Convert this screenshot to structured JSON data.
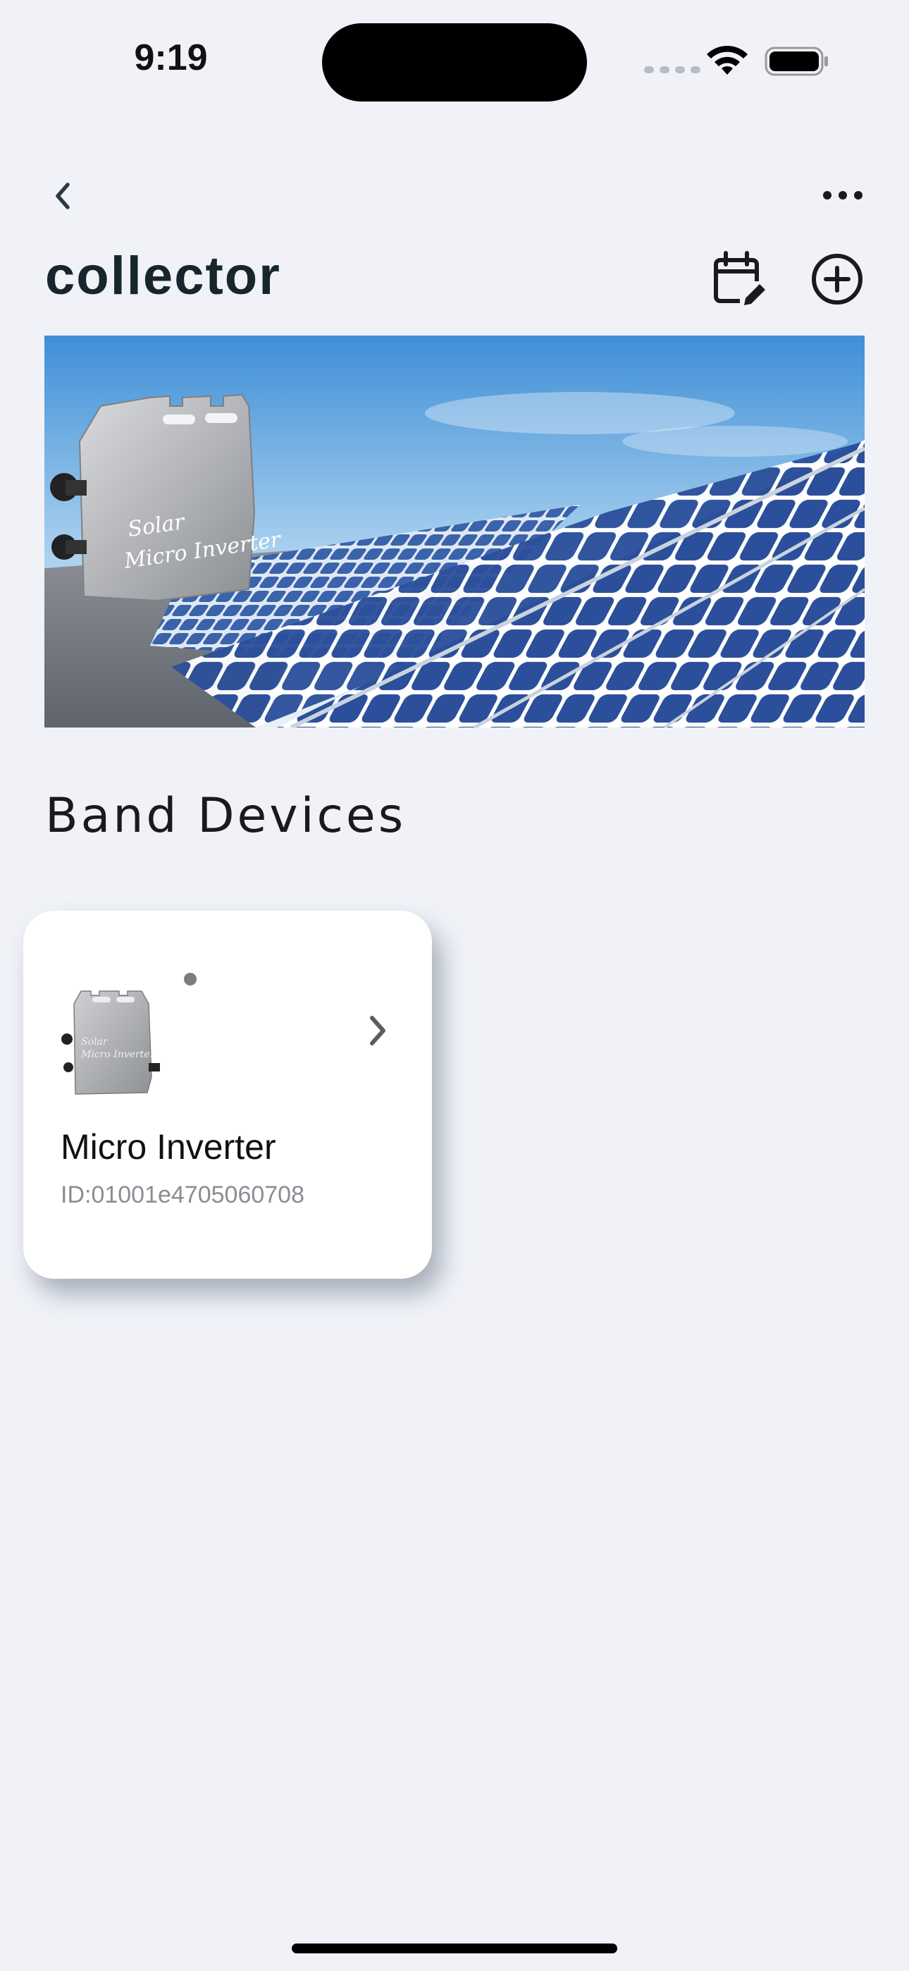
{
  "status_bar": {
    "time": "9:19"
  },
  "header": {
    "title": "collector",
    "back_icon": "chevron-left-icon",
    "more_icon": "ellipsis-icon",
    "schedule_icon": "calendar-edit-icon",
    "add_icon": "plus-circle-icon"
  },
  "banner": {
    "product_label_line1": "Solar",
    "product_label_line2": "Micro Inverter"
  },
  "section": {
    "title": "Band Devices"
  },
  "devices": [
    {
      "name": "Micro Inverter",
      "id": "ID:01001e4705060708",
      "status_color": "#7a7d82",
      "thumb_label_line1": "Solar",
      "thumb_label_line2": "Micro Inverter"
    }
  ],
  "colors": {
    "background": "#f0f2f8",
    "card": "#ffffff",
    "title_text": "#16262c",
    "sky_top": "#3f8fd6",
    "panel_blue": "#2b4f9a"
  }
}
